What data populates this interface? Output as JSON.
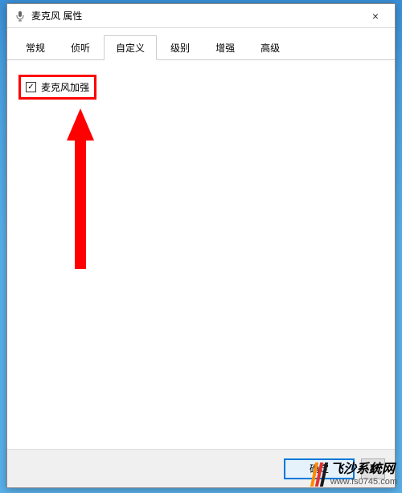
{
  "window": {
    "title": "麦克风 属性",
    "close": "×"
  },
  "tabs": [
    {
      "label": "常规",
      "active": false
    },
    {
      "label": "侦听",
      "active": false
    },
    {
      "label": "自定义",
      "active": true
    },
    {
      "label": "级别",
      "active": false
    },
    {
      "label": "增强",
      "active": false
    },
    {
      "label": "高级",
      "active": false
    }
  ],
  "content": {
    "checkbox": {
      "label": "麦克风加强",
      "checked": true,
      "checkmark": "✓"
    }
  },
  "footer": {
    "ok": "确定",
    "cancel_partial": "取"
  },
  "watermark": {
    "title": "飞沙系统网",
    "url": "www.fs0745.com"
  }
}
